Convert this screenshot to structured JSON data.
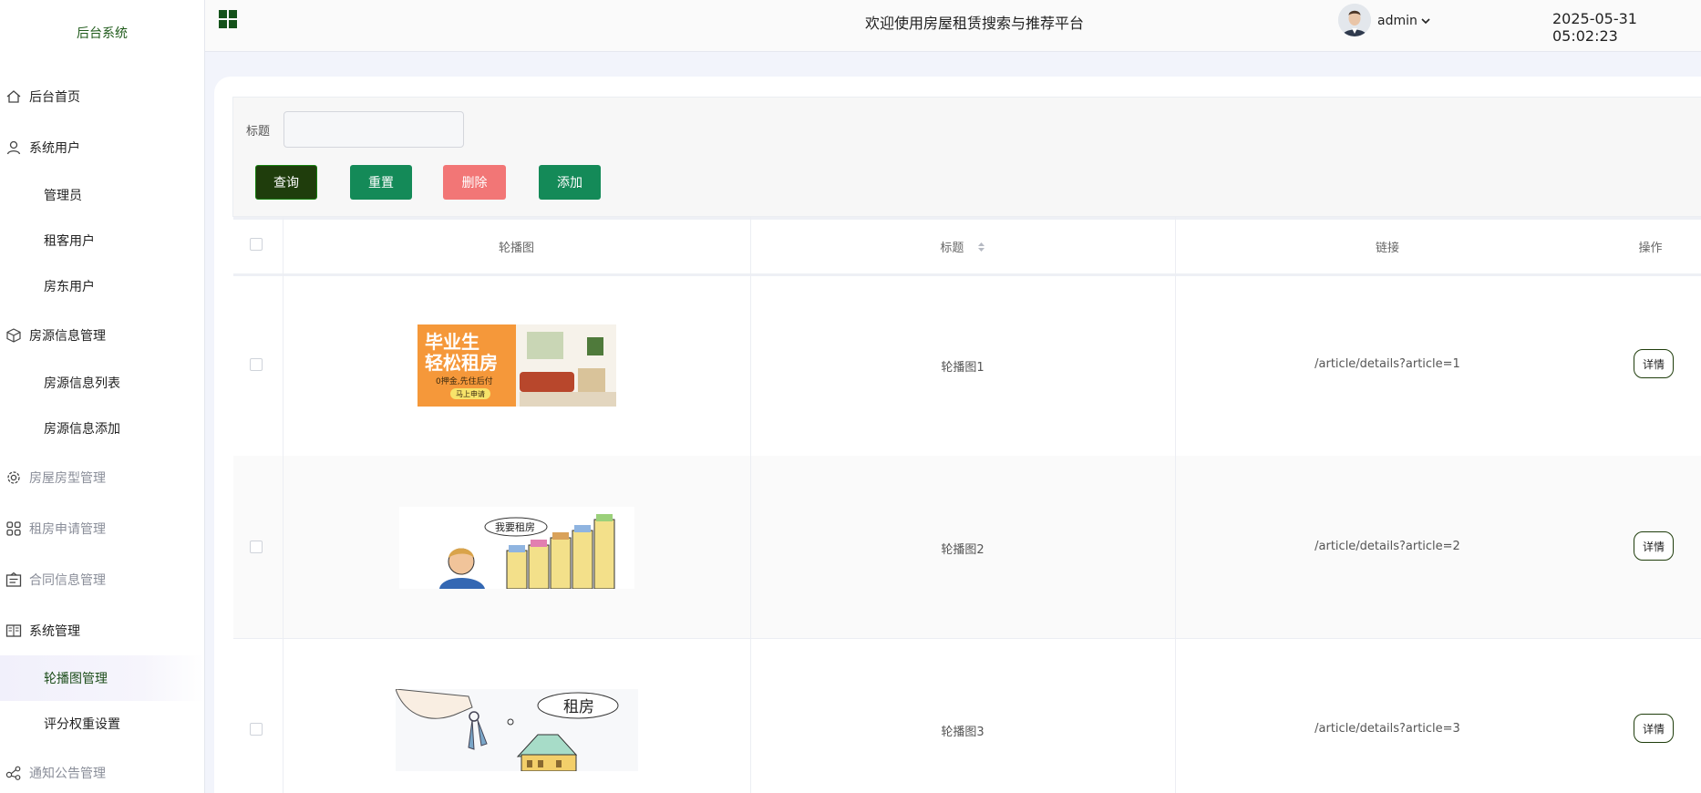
{
  "sidebar": {
    "brand": "后台系统",
    "items": [
      {
        "label": "后台首页",
        "icon": "home-icon"
      },
      {
        "label": "系统用户",
        "icon": "user-icon"
      },
      {
        "label": "管理员"
      },
      {
        "label": "租客用户"
      },
      {
        "label": "房东用户"
      },
      {
        "label": "房源信息管理",
        "icon": "box-icon"
      },
      {
        "label": "房源信息列表"
      },
      {
        "label": "房源信息添加"
      },
      {
        "label": "房屋房型管理",
        "icon": "gear-icon"
      },
      {
        "label": "租房申请管理",
        "icon": "grid-icon"
      },
      {
        "label": "合同信息管理",
        "icon": "sign-icon"
      },
      {
        "label": "系统管理",
        "icon": "book-icon"
      },
      {
        "label": "轮播图管理"
      },
      {
        "label": "评分权重设置"
      },
      {
        "label": "通知公告管理",
        "icon": "share-icon"
      }
    ]
  },
  "header": {
    "title": "欢迎使用房屋租赁搜索与推荐平台",
    "user": "admin",
    "datetime": "2025-05-31 05:02:23"
  },
  "search": {
    "label": "标题",
    "value": "",
    "placeholder": ""
  },
  "buttons": {
    "query": "查询",
    "reset": "重置",
    "delete": "删除",
    "add": "添加"
  },
  "table": {
    "columns": [
      "轮播图",
      "标题",
      "链接",
      "操作"
    ],
    "rows": [
      {
        "title": "轮播图1",
        "link": "/article/details?article=1",
        "action": "详情",
        "banner_text": [
          "毕业生",
          "轻松租房",
          "0押金,先住后付",
          "马上申请"
        ]
      },
      {
        "title": "轮播图2",
        "link": "/article/details?article=2",
        "action": "详情",
        "banner_text": [
          "我要租房"
        ]
      },
      {
        "title": "轮播图3",
        "link": "/article/details?article=3",
        "action": "详情",
        "banner_text": [
          "租房"
        ]
      }
    ]
  },
  "colors": {
    "brand_green": "#1f5a1a",
    "query_button": "#1f3d0c",
    "primary_button": "#148a58",
    "danger_button": "#f27676",
    "active_bg": "#f1f0fb"
  }
}
